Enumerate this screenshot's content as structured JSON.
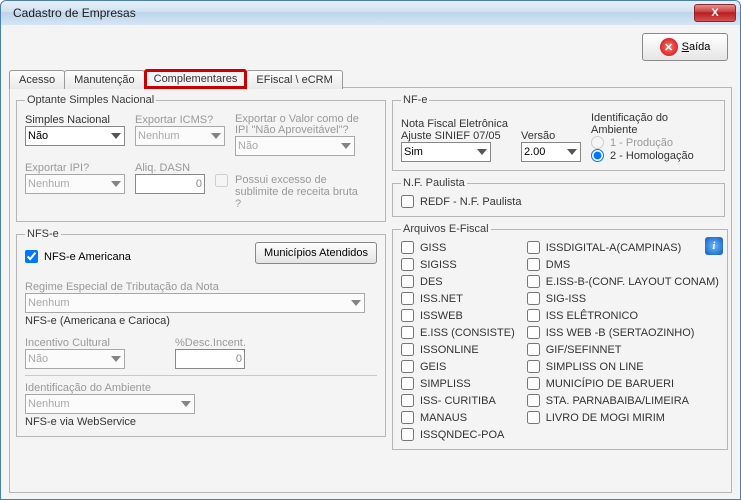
{
  "window": {
    "title": "Cadastro de Empresas"
  },
  "buttons": {
    "close": "X",
    "saida": "Saída",
    "municipios": "Municípios Atendidos"
  },
  "tabs": {
    "acesso": "Acesso",
    "manutencao": "Manutenção",
    "complementares": "Complementares",
    "efiscal": "EFiscal \\ eCRM"
  },
  "optante": {
    "legend": "Optante Simples Nacional",
    "simples_label": "Simples Nacional",
    "simples_value": "Não",
    "exp_icms_label": "Exportar ICMS?",
    "exp_icms_value": "Nenhum",
    "exp_valor_label": "Exportar o Valor como de IPI \"Não Aproveitável\"?",
    "exp_valor_value": "Não",
    "exp_ipi_label": "Exportar IPI?",
    "exp_ipi_value": "Nenhum",
    "aliq_label": "Aliq. DASN",
    "aliq_value": "0",
    "excesso_label": "Possui excesso de sublimite de receita bruta ?"
  },
  "nfse": {
    "legend": "NFS-e",
    "americana": "NFS-e Americana",
    "regime_label": "Regime Especial de Tributação da Nota",
    "regime_value": "Nenhum",
    "americana_carioca": "NFS-e (Americana e Carioca)",
    "incentivo_label": "Incentivo Cultural",
    "incentivo_value": "Não",
    "desc_label": "%Desc.Incent.",
    "desc_value": "0",
    "ambiente_label": "Identificação do Ambiente",
    "ambiente_value": "Nenhum",
    "via_ws": "NFS-e via WebService"
  },
  "nfe": {
    "legend": "NF-e",
    "nota_label": "Nota Fiscal Eletrônica",
    "ajuste_label": "Ajuste SINIEF 07/05",
    "ajuste_value": "Sim",
    "versao_label": "Versão",
    "versao_value": "2.00",
    "ambiente_label": "Identificação do Ambiente",
    "opt1": "1 - Produção",
    "opt2": "2 - Homologação"
  },
  "paulista": {
    "legend": "N.F. Paulista",
    "redf": "REDF - N.F. Paulista"
  },
  "efiscal": {
    "legend": "Arquivos E-Fiscal",
    "left": [
      "GISS",
      "SIGISS",
      "DES",
      "ISS.NET",
      "ISSWEB",
      "E.ISS (CONSISTE)",
      "ISSONLINE",
      "GEIS",
      "SIMPLISS",
      "ISS- CURITIBA",
      "MANAUS",
      "ISSQNDEC-POA"
    ],
    "right": [
      "ISSDIGITAL-A(CAMPINAS)",
      "DMS",
      "E.ISS-B-(CONF. LAYOUT CONAM)",
      "SIG-ISS",
      "ISS ELÊTRONICO",
      "ISS WEB -B (SERTAOZINHO)",
      "GIF/SEFINNET",
      "SIMPLISS ON LINE",
      "MUNICÍPIO DE BARUERI",
      "STA. PARNABAIBA/LIMEIRA",
      "LIVRO DE MOGI MIRIM"
    ]
  },
  "icons": {
    "close": "close-icon",
    "saida": "error-circle-icon",
    "info": "info-icon"
  }
}
